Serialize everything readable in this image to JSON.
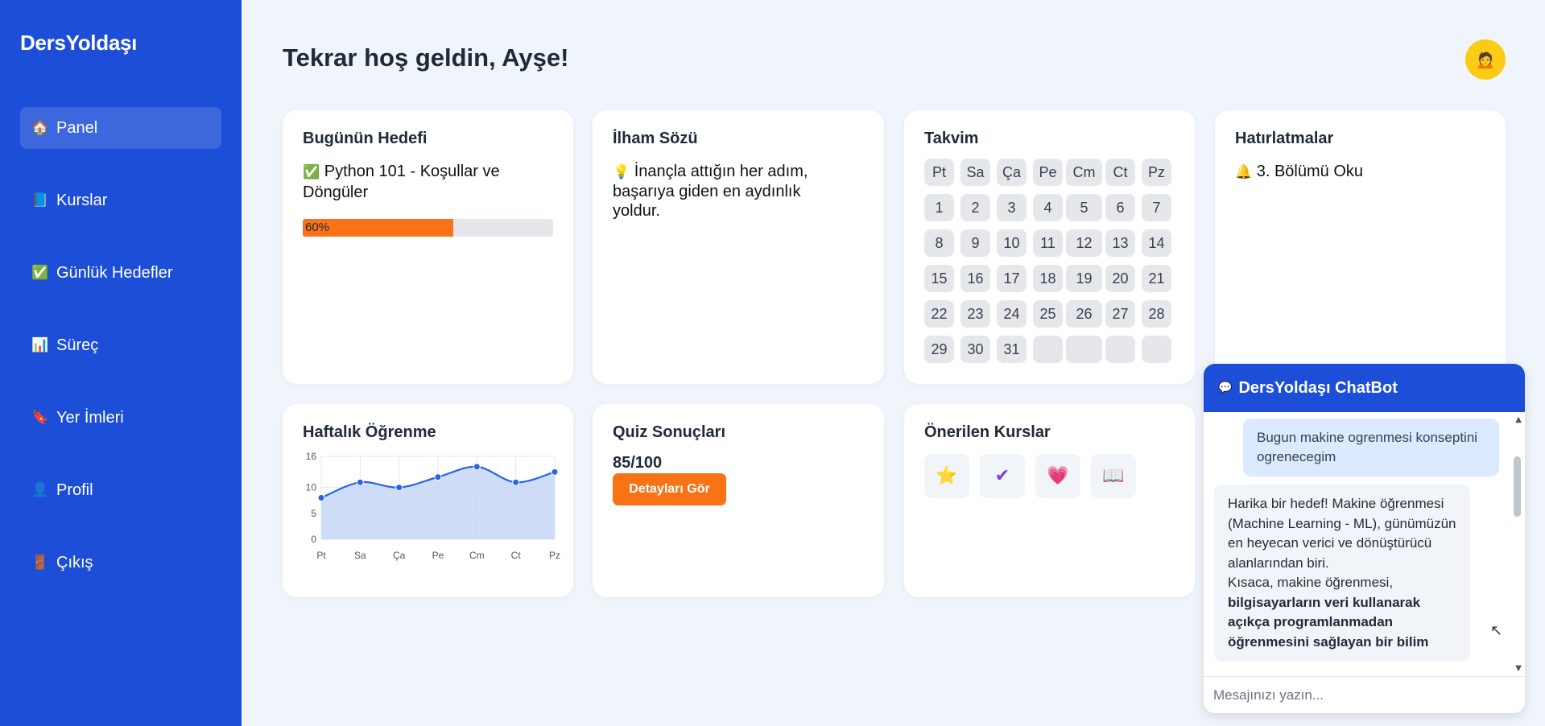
{
  "brand": "DersYoldaşı",
  "sidebar": {
    "items": [
      {
        "icon": "🏠",
        "icon_name": "home-icon",
        "label": "Panel",
        "active": true
      },
      {
        "icon": "📘",
        "icon_name": "book-icon",
        "label": "Kurslar"
      },
      {
        "icon": "✅",
        "icon_name": "check-icon",
        "label": "Günlük Hedefler"
      },
      {
        "icon": "📊",
        "icon_name": "chart-icon",
        "label": "Süreç"
      },
      {
        "icon": "🔖",
        "icon_name": "bookmark-icon",
        "label": "Yer İmleri"
      },
      {
        "icon": "👤",
        "icon_name": "user-icon",
        "label": "Profil"
      },
      {
        "icon": "🚪",
        "icon_name": "door-icon",
        "label": "Çıkış"
      }
    ]
  },
  "header": {
    "welcome": "Tekrar hoş geldin, Ayşe!",
    "avatar_icon": "🙍"
  },
  "goal": {
    "title": "Bugünün Hedefi",
    "icon": "✅",
    "text_line1": "Python 101 - Koşullar ve",
    "text_line2": "Döngüler",
    "progress_label": "60%",
    "progress": 0.6
  },
  "quote": {
    "title": "İlham Sözü",
    "icon": "💡",
    "line1": "İnançla attığın her adım,",
    "line2": "başarıya giden en aydınlık",
    "line3": "yoldur."
  },
  "calendar": {
    "title": "Takvim",
    "days": [
      "Pt",
      "Sa",
      "Ça",
      "Pe",
      "Cm",
      "Ct",
      "Pz"
    ],
    "dates": [
      "1",
      "2",
      "3",
      "4",
      "5",
      "6",
      "7",
      "8",
      "9",
      "10",
      "11",
      "12",
      "13",
      "14",
      "15",
      "16",
      "17",
      "18",
      "19",
      "20",
      "21",
      "22",
      "23",
      "24",
      "25",
      "26",
      "27",
      "28",
      "29",
      "30",
      "31",
      "",
      "",
      "",
      ""
    ]
  },
  "reminders": {
    "title": "Hatırlatmalar",
    "icon": "🔔",
    "item": "3. Bölümü Oku"
  },
  "weekly": {
    "title": "Haftalık Öğrenme"
  },
  "chart_data": {
    "type": "line",
    "categories": [
      "Pt",
      "Sa",
      "Ça",
      "Pe",
      "Cm",
      "Ct",
      "Pz"
    ],
    "values": [
      8,
      11,
      10,
      12,
      14,
      11,
      13
    ],
    "ylim": [
      0,
      16
    ],
    "yticks": [
      "16",
      "10",
      "5",
      "0"
    ],
    "ytick_values": [
      16,
      10,
      5,
      0
    ],
    "grid": true,
    "color": "#2563eb",
    "fill": "#c7d7f7"
  },
  "quiz": {
    "title": "Quiz Sonuçları",
    "score": "85/100",
    "button": "Detayları Gör"
  },
  "courses": {
    "title": "Önerilen Kurslar",
    "icons": [
      {
        "glyph": "⭐",
        "name": "star-icon"
      },
      {
        "glyph": "✔",
        "name": "checkmark-icon"
      },
      {
        "glyph": "💗",
        "name": "heart-icon"
      },
      {
        "glyph": "📖",
        "name": "open-book-icon"
      }
    ]
  },
  "chat": {
    "title": "DersYoldaşı ChatBot",
    "icon": "💬",
    "user_msg": "Bugun makine ogrenmesi konseptini ogrenecegim",
    "bot_p1": "Harika bir hedef! Makine öğrenmesi (Machine Learning - ML), günümüzün en heyecan verici ve dönüştürücü alanlarından biri.",
    "bot_p2_plain": "Kısaca, makine öğrenmesi, ",
    "bot_p2_bold": "bilgisayarların veri kullanarak açıkça programlanmadan öğrenmesini sağlayan bir bilim",
    "input_placeholder": "Mesajınızı yazın..."
  },
  "colors": {
    "sidebar": "#1d4ed8",
    "accent": "#f97316",
    "background": "#f0f4fb"
  }
}
